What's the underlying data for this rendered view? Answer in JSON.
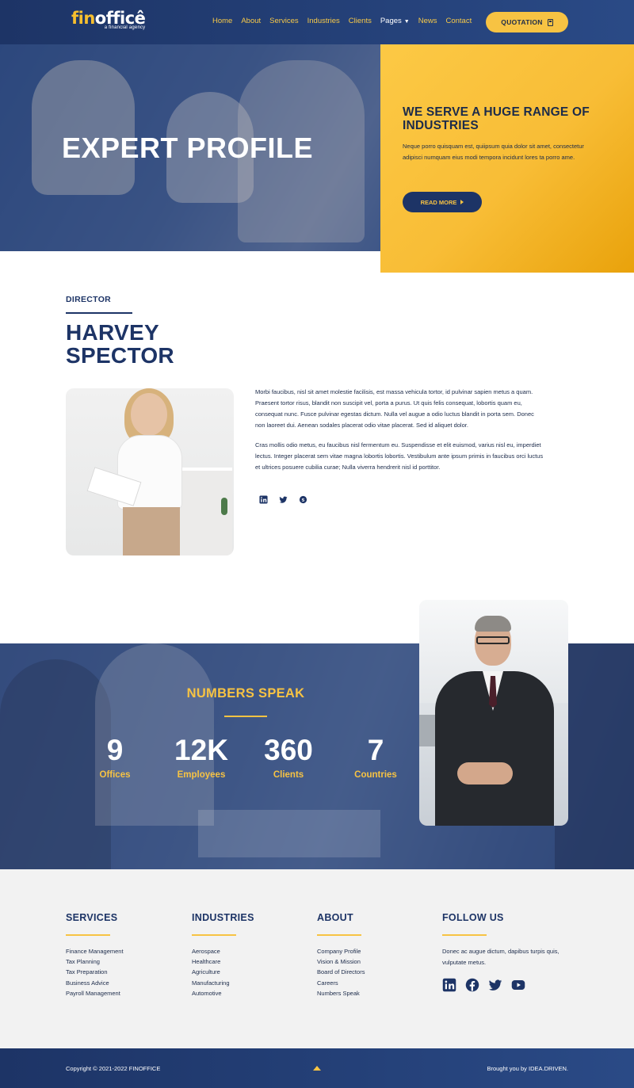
{
  "header": {
    "logo_fin": "fin",
    "logo_office": "officê",
    "logo_tagline": "a financial agency",
    "nav": [
      "Home",
      "About",
      "Services",
      "Industries",
      "Clients",
      "Pages",
      "News",
      "Contact"
    ],
    "quotation_label": "QUOTATION"
  },
  "hero": {
    "title": "EXPERT PROFILE",
    "card_title": "WE SERVE A HUGE RANGE OF INDUSTRIES",
    "card_text": "Neque porro quisquam est, quiipsum quia dolor sit amet, consectetur adipisci numquam eius modi tempora incidunt lores ta porro ame.",
    "read_more_label": "READ MORE"
  },
  "profile": {
    "role": "DIRECTOR",
    "name": "HARVEY SPECTOR",
    "bio_1": "Morbi faucibus, nisl sit amet molestie facilisis, est massa vehicula tortor, id pulvinar sapien metus a quam. Praesent tortor risus, blandit non suscipit vel, porta a purus. Ut quis felis consequat, lobortis quam eu, consequat nunc. Fusce pulvinar egestas dictum. Nulla vel augue a odio luctus blandit in porta sem. Donec non laoreet dui. Aenean sodales placerat odio vitae placerat. Sed id aliquet dolor.",
    "bio_2": "Cras mollis odio metus, eu faucibus nisl fermentum eu. Suspendisse et elit euismod, varius nisl eu, imperdiet lectus. Integer placerat sem vitae magna lobortis lobortis. Vestibulum ante ipsum primis in faucibus orci luctus et ultrices posuere cubilia curae; Nulla viverra hendrerit nisl id porttitor.",
    "social_icons": [
      "linkedin-icon",
      "twitter-icon",
      "skype-icon"
    ]
  },
  "numbers": {
    "title": "NUMBERS SPEAK",
    "stats": [
      {
        "value": "9",
        "label": "Offices"
      },
      {
        "value": "12K",
        "label": "Employees"
      },
      {
        "value": "360",
        "label": "Clients"
      },
      {
        "value": "7",
        "label": "Countries"
      }
    ]
  },
  "footer": {
    "services_title": "SERVICES",
    "services": [
      "Finance Management",
      "Tax Planning",
      "Tax Preparation",
      "Business Advice",
      "Payroll Management"
    ],
    "industries_title": "INDUSTRIES",
    "industries": [
      "Aerospace",
      "Healthcare",
      "Agriculture",
      "Manufacturing",
      "Automotive"
    ],
    "about_title": "ABOUT",
    "about": [
      "Company Profile",
      "Vision & Mission",
      "Board of Directors",
      "Careers",
      "Numbers Speak"
    ],
    "follow_title": "FOLLOW US",
    "follow_text": "Donec ac augue dictum, dapibus turpis quis, vulputate metus.",
    "follow_icons": [
      "linkedin-icon",
      "facebook-icon",
      "twitter-icon",
      "youtube-icon"
    ]
  },
  "bottom": {
    "copyright": "Copyright © 2021-2022 FINOFFICE",
    "brought": "Brought you by IDEA.DRIVEN."
  },
  "colors": {
    "navy": "#1d3466",
    "accent_yellow": "#f7c343",
    "footer_bg": "#f2f2f2"
  }
}
